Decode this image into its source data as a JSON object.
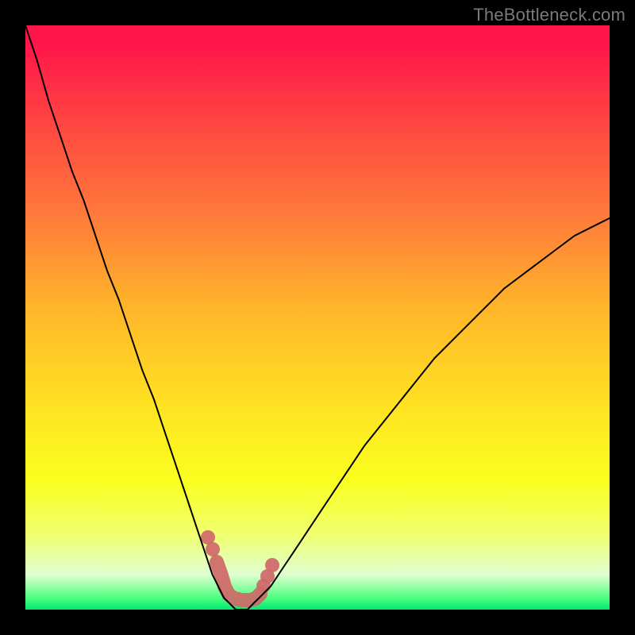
{
  "watermark": "TheBottleneck.com",
  "colors": {
    "frame": "#000000",
    "curve": "#000000",
    "fuzzy": "#cf6868",
    "gradient_top": "#ff154a",
    "gradient_bottom": "#00e874"
  },
  "chart_data": {
    "type": "line",
    "title": "",
    "xlabel": "",
    "ylabel": "",
    "xlim": [
      0,
      100
    ],
    "ylim": [
      0,
      100
    ],
    "x": [
      0,
      2,
      4,
      6,
      8,
      10,
      12,
      14,
      16,
      18,
      20,
      22,
      24,
      26,
      28,
      29,
      30,
      31,
      32,
      33,
      34,
      35,
      36,
      37,
      38,
      39,
      40,
      42,
      44,
      46,
      48,
      50,
      54,
      58,
      62,
      66,
      70,
      74,
      78,
      82,
      86,
      90,
      94,
      98,
      100
    ],
    "values": [
      100,
      94,
      87,
      81,
      75,
      70,
      64,
      58,
      53,
      47,
      41,
      36,
      30,
      24,
      18,
      15,
      12,
      9,
      6,
      4,
      2,
      1,
      0,
      0,
      0,
      1,
      2,
      4,
      7,
      10,
      13,
      16,
      22,
      28,
      33,
      38,
      43,
      47,
      51,
      55,
      58,
      61,
      64,
      66,
      67
    ],
    "annotations": [
      {
        "type": "fuzzy_band",
        "x_range": [
          31,
          42
        ],
        "note": "salmon dotted band near trough"
      }
    ]
  }
}
